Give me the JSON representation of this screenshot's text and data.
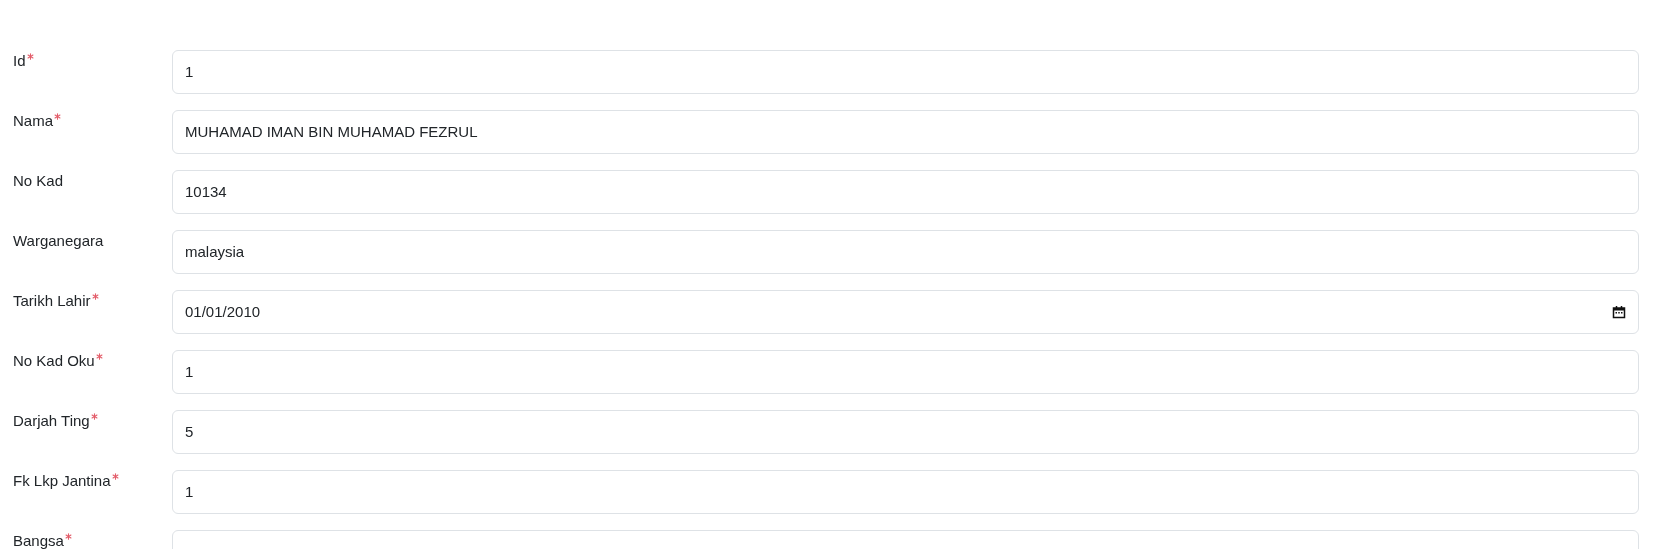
{
  "fields": [
    {
      "label": "Id",
      "required": true,
      "kind": "text",
      "value": "1"
    },
    {
      "label": "Nama",
      "required": true,
      "kind": "text",
      "value": "MUHAMAD IMAN BIN MUHAMAD FEZRUL"
    },
    {
      "label": "No Kad",
      "required": false,
      "kind": "text",
      "value": "10134"
    },
    {
      "label": "Warganegara",
      "required": false,
      "kind": "text",
      "value": "malaysia"
    },
    {
      "label": "Tarikh Lahir",
      "required": true,
      "kind": "date",
      "value": "01/01/2010"
    },
    {
      "label": "No Kad Oku",
      "required": true,
      "kind": "text",
      "value": "1"
    },
    {
      "label": "Darjah Ting",
      "required": true,
      "kind": "text",
      "value": "5"
    },
    {
      "label": "Fk Lkp Jantina",
      "required": true,
      "kind": "text",
      "value": "1"
    },
    {
      "label": "Bangsa",
      "required": true,
      "kind": "text"
    }
  ]
}
